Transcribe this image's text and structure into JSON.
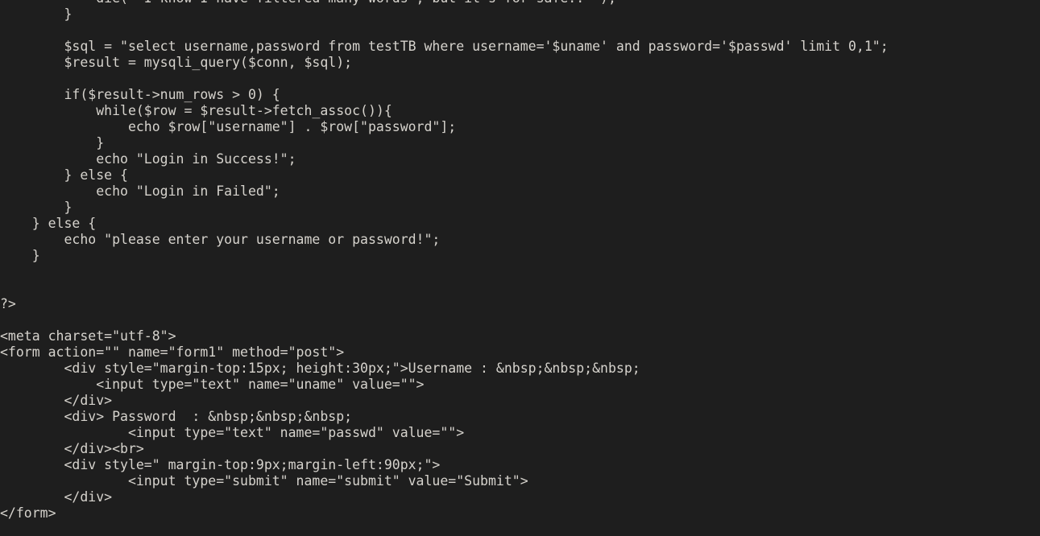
{
  "editor": {
    "background_color": "#1e1e1e",
    "text_color": "#d6d3cd",
    "font_size_px": 16.5,
    "line_height_px": 20,
    "language": "php",
    "line_numbers_visible": false,
    "cursor_visible": false
  },
  "code": {
    "lines": [
      "            die( \"I know I have filtered many words\", but it's for safe..\" );",
      "        }",
      "",
      "        $sql = \"select username,password from testTB where username='$uname' and password='$passwd' limit 0,1\";",
      "        $result = mysqli_query($conn, $sql);",
      "",
      "        if($result->num_rows > 0) {",
      "            while($row = $result->fetch_assoc()){",
      "                echo $row[\"username\"] . $row[\"password\"];",
      "            }",
      "            echo \"Login in Success!\";",
      "        } else {",
      "            echo \"Login in Failed\";",
      "        }",
      "    } else {",
      "        echo \"please enter your username or password!\";",
      "    }",
      "",
      "",
      "?>",
      "",
      "<meta charset=\"utf-8\">",
      "<form action=\"\" name=\"form1\" method=\"post\">",
      "        <div style=\"margin-top:15px; height:30px;\">Username : &nbsp;&nbsp;&nbsp;",
      "            <input type=\"text\" name=\"uname\" value=\"\">",
      "        </div>",
      "        <div> Password  : &nbsp;&nbsp;&nbsp;",
      "                <input type=\"text\" name=\"passwd\" value=\"\">",
      "        </div><br>",
      "        <div style=\" margin-top:9px;margin-left:90px;\">",
      "                <input type=\"submit\" name=\"submit\" value=\"Submit\">",
      "        </div>",
      "</form>"
    ]
  }
}
